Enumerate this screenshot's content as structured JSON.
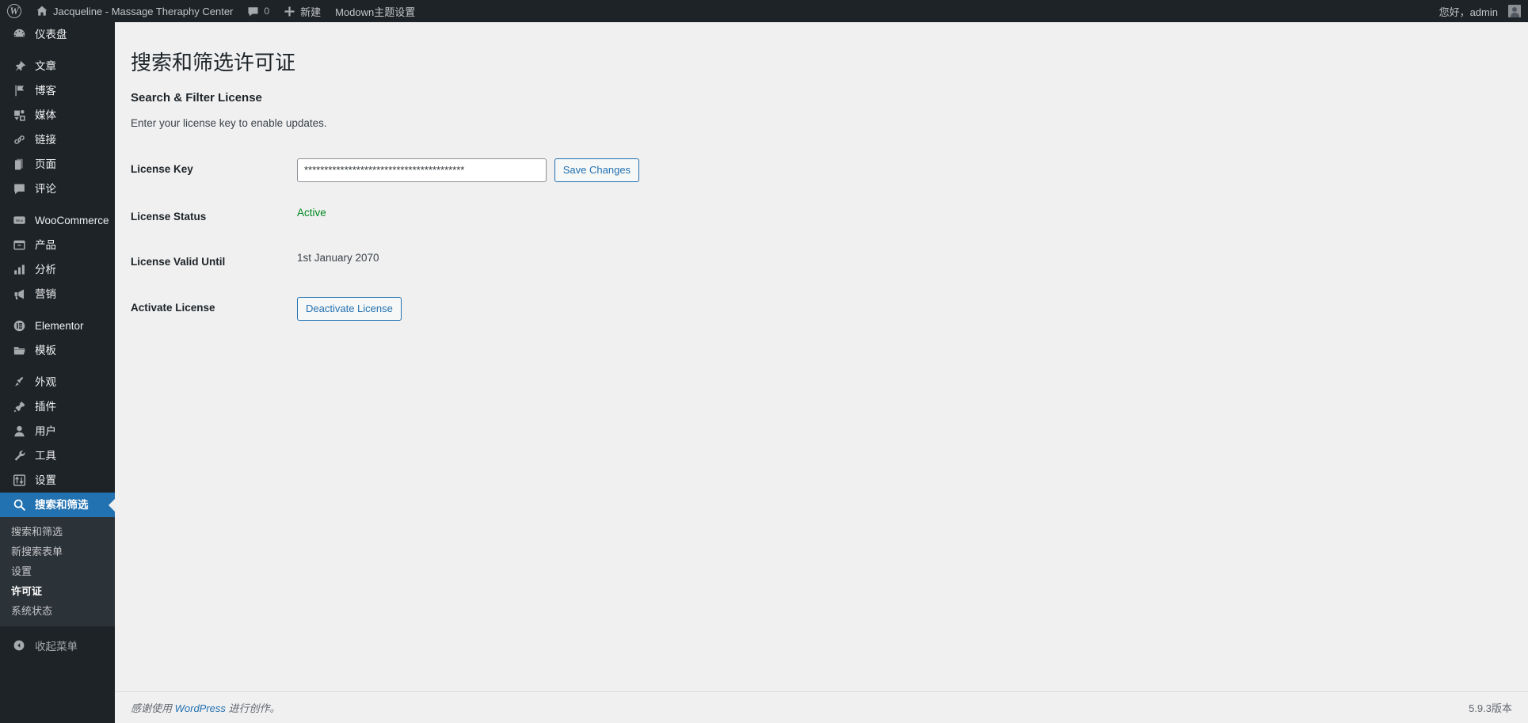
{
  "adminbar": {
    "wp_logo_label": "W",
    "site_name": "Jacqueline - Massage Theraphy Center",
    "comments_count": "0",
    "new_label": "新建",
    "theme_settings_label": "Modown主题设置",
    "howdy": "您好，admin"
  },
  "sidebar": {
    "items": [
      {
        "label": "仪表盘",
        "icon": "dashboard-icon",
        "sep_after": true
      },
      {
        "label": "文章",
        "icon": "pin-icon",
        "sep_after": false
      },
      {
        "label": "博客",
        "icon": "flag-icon",
        "sep_after": false
      },
      {
        "label": "媒体",
        "icon": "media-icon",
        "sep_after": false
      },
      {
        "label": "链接",
        "icon": "link-icon",
        "sep_after": false
      },
      {
        "label": "页面",
        "icon": "page-icon",
        "sep_after": false
      },
      {
        "label": "评论",
        "icon": "comment-icon",
        "sep_after": true
      },
      {
        "label": "WooCommerce",
        "icon": "woocommerce-icon",
        "sep_after": false
      },
      {
        "label": "产品",
        "icon": "product-icon",
        "sep_after": false
      },
      {
        "label": "分析",
        "icon": "analytics-icon",
        "sep_after": false
      },
      {
        "label": "营销",
        "icon": "marketing-icon",
        "sep_after": true
      },
      {
        "label": "Elementor",
        "icon": "elementor-icon",
        "sep_after": false
      },
      {
        "label": "模板",
        "icon": "folder-icon",
        "sep_after": true
      },
      {
        "label": "外观",
        "icon": "appearance-icon",
        "sep_after": false
      },
      {
        "label": "插件",
        "icon": "plugins-icon",
        "sep_after": false
      },
      {
        "label": "用户",
        "icon": "users-icon",
        "sep_after": false
      },
      {
        "label": "工具",
        "icon": "tools-icon",
        "sep_after": false
      },
      {
        "label": "设置",
        "icon": "settings-icon",
        "sep_after": false
      }
    ],
    "current": {
      "label": "搜索和筛选",
      "icon": "search-icon"
    },
    "submenu": [
      {
        "label": "搜索和筛选",
        "current": false
      },
      {
        "label": "新搜索表单",
        "current": false
      },
      {
        "label": "设置",
        "current": false
      },
      {
        "label": "许可证",
        "current": true
      },
      {
        "label": "系统状态",
        "current": false
      }
    ],
    "collapse_label": "收起菜单"
  },
  "main": {
    "page_title": "搜索和筛选许可证",
    "section_title": "Search & Filter License",
    "section_desc": "Enter your license key to enable updates.",
    "rows": {
      "license_key_label": "License Key",
      "license_key_value": "****************************************",
      "save_button": "Save Changes",
      "license_status_label": "License Status",
      "license_status_value": "Active",
      "license_valid_label": "License Valid Until",
      "license_valid_value": "1st January 2070",
      "activate_label": "Activate License",
      "deactivate_button": "Deactivate License"
    }
  },
  "footer": {
    "thanks_prefix": "感谢使用 ",
    "wordpress_link": "WordPress",
    "thanks_suffix": " 进行创作。",
    "version": "5.9.3版本"
  },
  "colors": {
    "sidebar_bg": "#1d2327",
    "submenu_bg": "#2c3338",
    "accent_blue": "#2271b1",
    "content_bg": "#f0f0f1",
    "status_green": "#008a20"
  }
}
